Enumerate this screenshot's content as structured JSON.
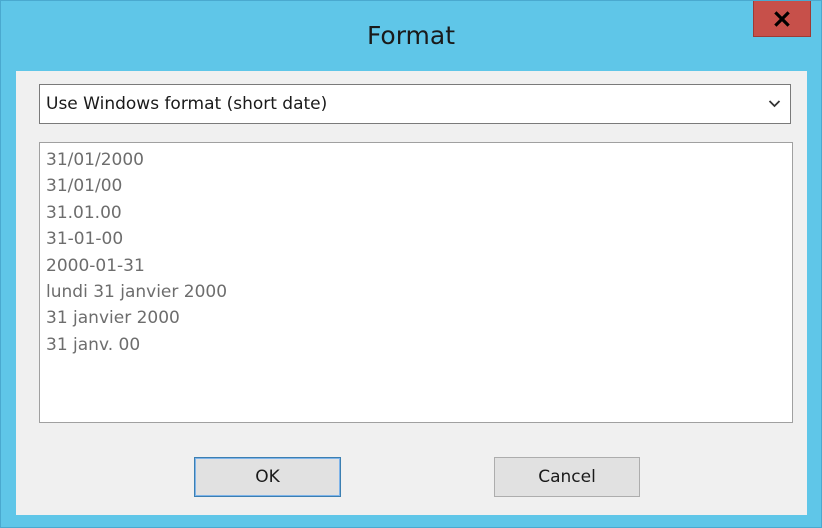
{
  "window": {
    "title": "Format"
  },
  "format_select": {
    "value": "Use Windows format (short date)"
  },
  "format_list": {
    "items": [
      "31/01/2000",
      "31/01/00",
      "31.01.00",
      "31-01-00",
      "2000-01-31",
      "lundi 31 janvier 2000",
      "31 janvier 2000",
      "31 janv. 00"
    ]
  },
  "buttons": {
    "ok_label": "OK",
    "cancel_label": "Cancel"
  },
  "icons": {
    "close": "close-icon",
    "dropdown": "chevron-down-icon"
  },
  "colors": {
    "title_bar": "#5fc6e8",
    "close_button": "#c7504a",
    "dialog_background": "#f0f0f0",
    "list_text": "#6d6d6d"
  }
}
